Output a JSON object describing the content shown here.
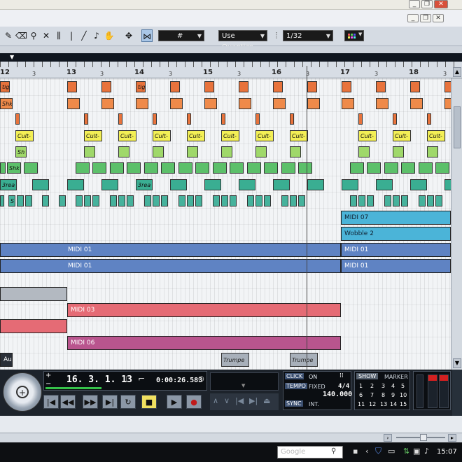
{
  "window": {
    "minimize_icon": "minimize-icon",
    "restore_icon": "restore-icon",
    "close_icon": "close-icon"
  },
  "toolbar": {
    "snap_grid_value": "#",
    "quantize_mode": "Use Quantize",
    "quantize_value": "1/32"
  },
  "ruler": {
    "bars": [
      {
        "label": "12",
        "beat": "3"
      },
      {
        "label": "13",
        "beat": "3"
      },
      {
        "label": "14",
        "beat": "3"
      },
      {
        "label": "15",
        "beat": "3"
      },
      {
        "label": "16",
        "beat": "3"
      },
      {
        "label": "17",
        "beat": "3"
      },
      {
        "label": "18",
        "beat": "3"
      }
    ]
  },
  "tracks": {
    "row1_label": "tig",
    "row2_label": "Shk",
    "row4_label": "Cult-",
    "row5_label": "Sh",
    "row6_label": "Shk",
    "row7_label": "3rea",
    "row8_label": "S",
    "midi07": "MIDI 07",
    "wobble2": "Wobble 2",
    "midi01": "MIDI 01",
    "midi03": "MIDI 03",
    "midi06": "MIDI 06",
    "trumpet": "Trumpe",
    "audio": "Aud"
  },
  "transport": {
    "position_bars": "16. 3. 1. 13",
    "position_time": "0:00:26.583",
    "click_label": "CLICK",
    "click_state": "ON",
    "tempo_label": "TEMPO",
    "tempo_mode": "FIXED",
    "signature": "4/4",
    "tempo_value": "140.000",
    "sync_label": "SYNC",
    "sync_value": "INT.",
    "show_label": "SHOW",
    "marker_label": "MARKER",
    "markers": [
      "1",
      "2",
      "3",
      "4",
      "5",
      "6",
      "7",
      "8",
      "9",
      "10",
      "11",
      "12",
      "13",
      "14",
      "15"
    ]
  },
  "taskbar": {
    "search_logo": "Google",
    "clock": "15:07"
  },
  "colors": {
    "orange": "#e8733c",
    "yellow": "#f3ef55",
    "lime": "#9fd86a",
    "green": "#5cc06a",
    "teal": "#3aae92",
    "cyan": "#4bb4d8",
    "blue": "#5f83c3",
    "red": "#e56b75",
    "magenta": "#b9558e"
  }
}
